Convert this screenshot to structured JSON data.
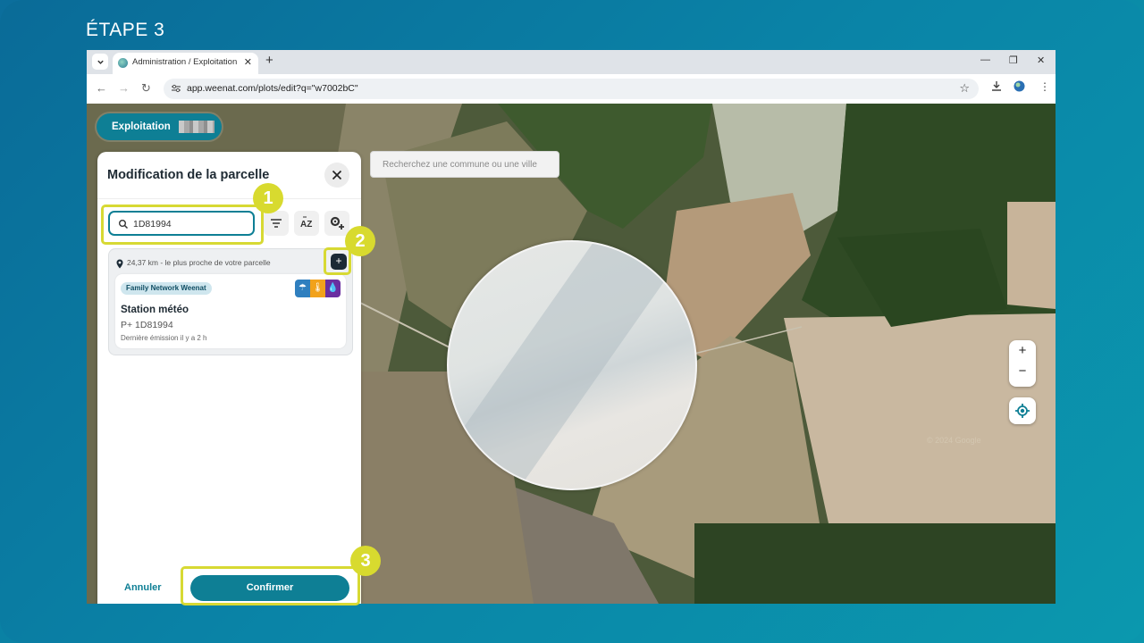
{
  "step": {
    "title": "ÉTAPE 3"
  },
  "browser": {
    "tab_title": "Administration / Exploitation Sa",
    "url": "app.weenat.com/plots/edit?q=\"w7002bC\""
  },
  "map": {
    "exploitation_label": "Exploitation",
    "search_placeholder": "Recherchez une commune ou une ville",
    "zoom_in": "+",
    "zoom_out": "−"
  },
  "panel": {
    "title": "Modification de la parcelle",
    "search_value": "1D81994",
    "result": {
      "distance": "24,37 km - le plus proche de votre parcelle",
      "network": "Family Network Weenat",
      "station_name": "Station météo",
      "station_id": "P+ 1D81994",
      "last_emission": "Dernière émission il y a 2 h"
    },
    "cancel_label": "Annuler",
    "confirm_label": "Confirmer"
  },
  "annotations": {
    "badge1": "1",
    "badge2": "2",
    "badge3": "3"
  },
  "colors": {
    "accent": "#0e7f95",
    "highlight": "#d7d933",
    "sensor_rain": "#2f7fbf",
    "sensor_temp": "#f2a21b",
    "sensor_humidity": "#6a2fa0"
  }
}
